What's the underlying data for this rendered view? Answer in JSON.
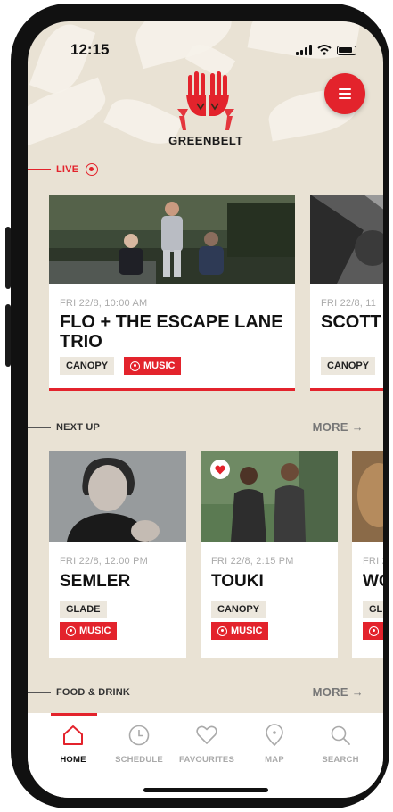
{
  "status_bar": {
    "time": "12:15"
  },
  "brand": {
    "name": "GREENBELT"
  },
  "sections": {
    "live": "LIVE",
    "next_up": "NEXT UP",
    "food_drink": "FOOD & DRINK",
    "more_label": "MORE →"
  },
  "live_cards": [
    {
      "datetime": "FRI 22/8, 10:00 AM",
      "title_line1": "FLO + THE ESCAPE LANE",
      "title_line2": "TRIO",
      "venue": "CANOPY",
      "category": "MUSIC"
    },
    {
      "datetime": "FRI 22/8, 11",
      "title_line1": "SCOTT",
      "venue": "CANOPY"
    }
  ],
  "next_cards": [
    {
      "datetime": "FRI 22/8, 12:00 PM",
      "title": "SEMLER",
      "venue": "GLADE",
      "category": "MUSIC"
    },
    {
      "datetime": "FRI 22/8, 2:15 PM",
      "title": "TOUKI",
      "venue": "CANOPY",
      "category": "MUSIC",
      "favourite": true
    },
    {
      "datetime": "FRI 2",
      "title": "WO",
      "venue": "GL"
    }
  ],
  "nav": [
    {
      "label": "HOME",
      "icon": "home-icon",
      "active": true
    },
    {
      "label": "SCHEDULE",
      "icon": "clock-icon"
    },
    {
      "label": "FAVOURITES",
      "icon": "heart-icon"
    },
    {
      "label": "MAP",
      "icon": "map-pin-icon"
    },
    {
      "label": "SEARCH",
      "icon": "search-icon"
    }
  ],
  "colors": {
    "accent": "#e3232c",
    "background": "#e9e2d4",
    "card": "#ffffff"
  }
}
